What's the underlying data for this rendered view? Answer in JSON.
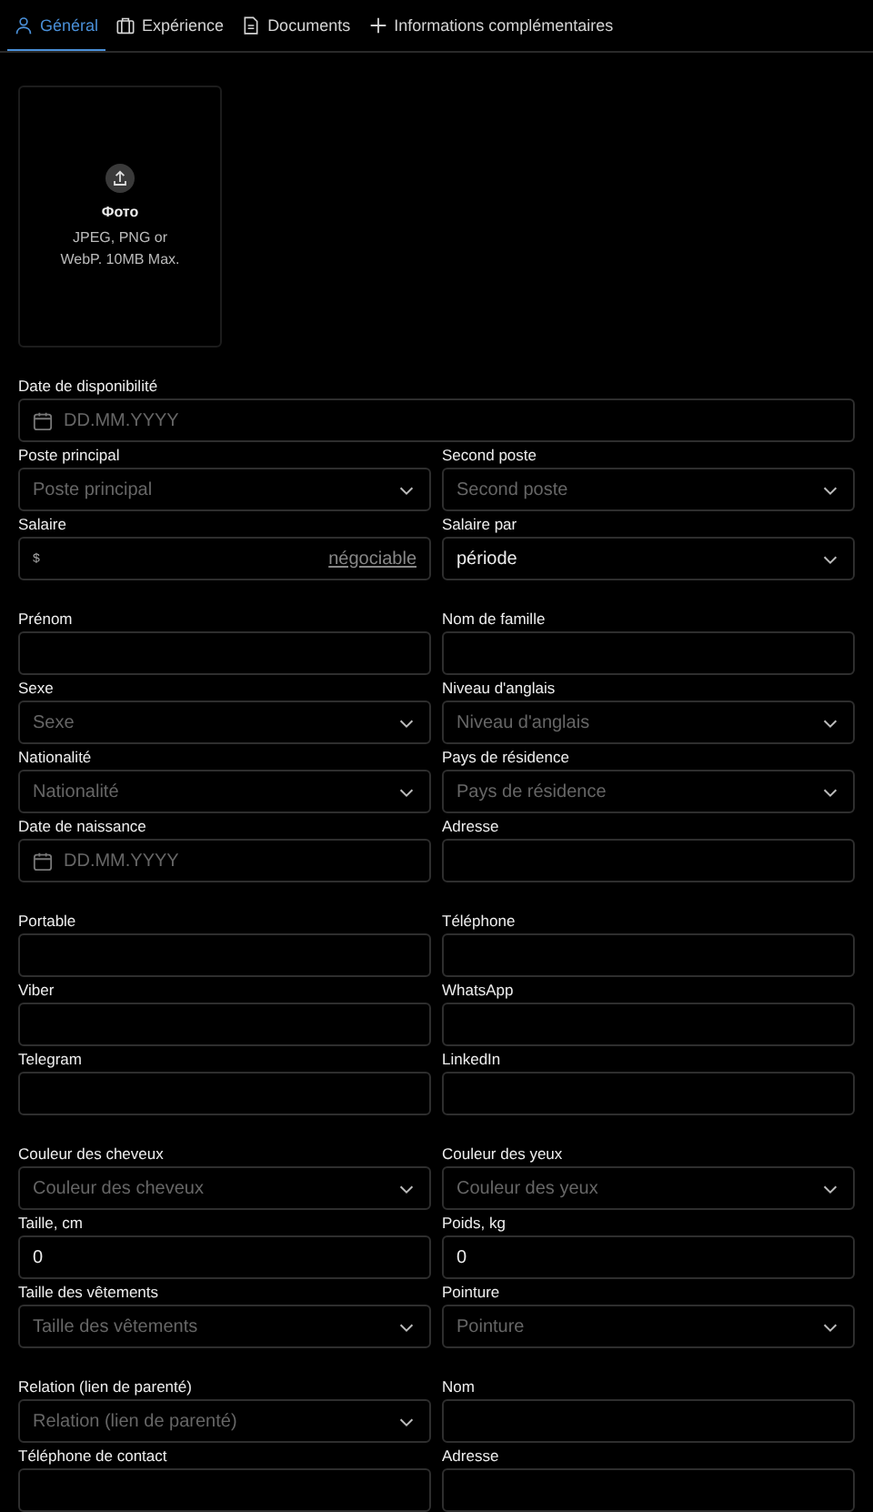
{
  "tabs": [
    {
      "label": "Général",
      "kind": "person",
      "selected": true
    },
    {
      "label": "Expérience",
      "kind": "briefcase",
      "selected": false
    },
    {
      "label": "Documents",
      "kind": "document",
      "selected": false
    },
    {
      "label": "Informations complémentaires",
      "kind": "plus",
      "selected": false
    }
  ],
  "photo_upload": {
    "title": "Фото",
    "hint": "JPEG, PNG or WebP. 10MB Max."
  },
  "sections": [
    {
      "rows": [
        [
          {
            "label": "Date de disponibilité",
            "kind": "date",
            "placeholder": "DD.MM.YYYY"
          }
        ],
        [
          {
            "label": "Poste principal",
            "kind": "select",
            "placeholder": "Poste principal"
          },
          {
            "label": "Second poste",
            "kind": "select",
            "placeholder": "Second poste"
          }
        ],
        [
          {
            "label": "Salaire",
            "kind": "money",
            "prefix": "$",
            "link": "négociable"
          },
          {
            "label": "Salaire par",
            "kind": "select",
            "value": "période"
          }
        ]
      ]
    },
    {
      "rows": [
        [
          {
            "label": "Prénom",
            "kind": "text"
          },
          {
            "label": "Nom de famille",
            "kind": "text"
          }
        ],
        [
          {
            "label": "Sexe",
            "kind": "select",
            "placeholder": "Sexe"
          },
          {
            "label": "Niveau d'anglais",
            "kind": "select",
            "placeholder": "Niveau d'anglais"
          }
        ],
        [
          {
            "label": "Nationalité",
            "kind": "select",
            "placeholder": "Nationalité"
          },
          {
            "label": "Pays de résidence",
            "kind": "select",
            "placeholder": "Pays de résidence"
          }
        ],
        [
          {
            "label": "Date de naissance",
            "kind": "date",
            "placeholder": "DD.MM.YYYY"
          },
          {
            "label": "Adresse",
            "kind": "text"
          }
        ]
      ]
    },
    {
      "rows": [
        [
          {
            "label": "Portable",
            "kind": "text"
          },
          {
            "label": "Téléphone",
            "kind": "text"
          }
        ],
        [
          {
            "label": "Viber",
            "kind": "text"
          },
          {
            "label": "WhatsApp",
            "kind": "text"
          }
        ],
        [
          {
            "label": "Telegram",
            "kind": "text"
          },
          {
            "label": "LinkedIn",
            "kind": "text"
          }
        ]
      ]
    },
    {
      "rows": [
        [
          {
            "label": "Couleur des cheveux",
            "kind": "select",
            "placeholder": "Couleur des cheveux"
          },
          {
            "label": "Couleur des yeux",
            "kind": "select",
            "placeholder": "Couleur des yeux"
          }
        ],
        [
          {
            "label": "Taille, cm",
            "kind": "text",
            "value": "0"
          },
          {
            "label": "Poids, kg",
            "kind": "text",
            "value": "0"
          }
        ],
        [
          {
            "label": "Taille des vêtements",
            "kind": "select",
            "placeholder": "Taille des vêtements"
          },
          {
            "label": "Pointure",
            "kind": "select",
            "placeholder": "Pointure"
          }
        ]
      ]
    },
    {
      "rows": [
        [
          {
            "label": "Relation (lien de parenté)",
            "kind": "select",
            "placeholder": "Relation (lien de parenté)"
          },
          {
            "label": "Nom",
            "kind": "text"
          }
        ],
        [
          {
            "label": "Téléphone de contact",
            "kind": "text"
          },
          {
            "label": "Adresse",
            "kind": "text"
          }
        ]
      ]
    }
  ]
}
